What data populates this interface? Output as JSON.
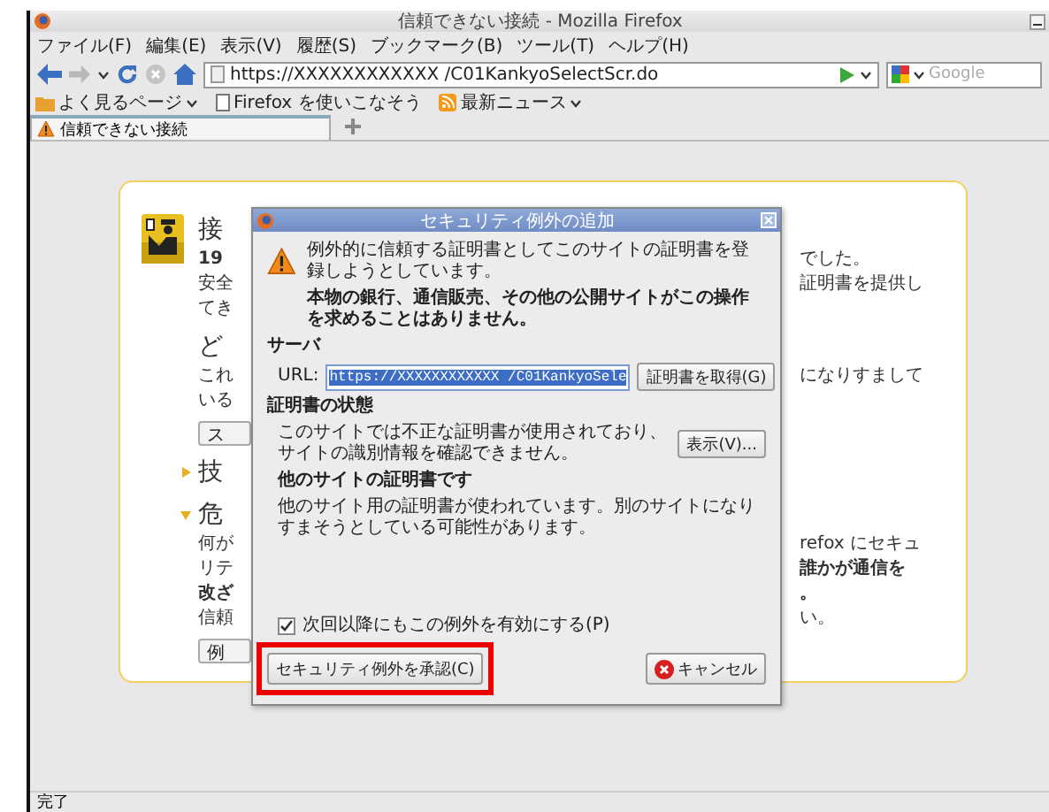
{
  "window": {
    "title": "信頼できない接続 - Mozilla Firefox"
  },
  "menu": [
    "ファイル(F)",
    "編集(E)",
    "表示(V)",
    "履歴(S)",
    "ブックマーク(B)",
    "ツール(T)",
    "ヘルプ(H)"
  ],
  "navigation": {
    "url": "https://XXXXXXXXXXXX /C01KankyoSelectScr.do",
    "search": {
      "placeholder": "Google"
    }
  },
  "bookmarks": [
    {
      "label": "よく見るページ",
      "kind": "folder"
    },
    {
      "label": "Firefox を使いこなそう",
      "kind": "page"
    },
    {
      "label": "最新ニュース",
      "kind": "feed"
    }
  ],
  "tabs": [
    {
      "label": "信頼できない接続",
      "selected": true
    }
  ],
  "error_page": {
    "rows": [
      {
        "kind": "heading",
        "left": {
          "text": "接",
          "bold": false
        }
      },
      {
        "kind": "text",
        "left": {
          "text": "19",
          "bold": true
        },
        "right": {
          "text": "でした。",
          "bold": false
        }
      },
      {
        "kind": "text",
        "left": {
          "text": "安全",
          "bold": false
        },
        "right": {
          "text": "証明書を提供し",
          "bold": false
        }
      },
      {
        "kind": "text",
        "left": {
          "text": "てき",
          "bold": false
        }
      },
      {
        "kind": "heading",
        "left": {
          "text": "ど",
          "bold": false
        }
      },
      {
        "kind": "text",
        "left": {
          "text": "これ",
          "bold": false
        },
        "right": {
          "text": "になりすまして",
          "bold": false
        }
      },
      {
        "kind": "text",
        "left": {
          "text": "いる",
          "bold": false
        }
      },
      {
        "kind": "button",
        "left": {
          "text": "ス",
          "bold": false
        }
      },
      {
        "kind": "toggle",
        "expanded": false,
        "left": {
          "text": "技",
          "bold": false
        }
      },
      {
        "kind": "toggle",
        "expanded": true,
        "left": {
          "text": "危",
          "bold": false
        }
      },
      {
        "kind": "text",
        "left": {
          "text": "何が",
          "bold": false
        },
        "right": {
          "text": "refox にセキュ",
          "bold": false
        }
      },
      {
        "kind": "text",
        "left": {
          "text": "リテ",
          "bold": false
        },
        "right": {
          "text": "誰かが通信を",
          "bold": true
        }
      },
      {
        "kind": "text",
        "left": {
          "text": "改ざ",
          "bold": true
        },
        "right": {
          "text": "。",
          "bold": true
        }
      },
      {
        "kind": "text",
        "left": {
          "text": "信頼",
          "bold": false
        },
        "right": {
          "text": "い。",
          "bold": false
        }
      },
      {
        "kind": "button",
        "left": {
          "text": "例",
          "bold": false
        }
      }
    ]
  },
  "dialog": {
    "title": "セキュリティ例外の追加",
    "intro": "例外的に信頼する証明書としてこのサイトの証明書を登録しようとしています。",
    "warning": "本物の銀行、通信販売、その他の公開サイトがこの操作を求めることはありません。",
    "server_label": "サーバ",
    "url_label": "URL:",
    "url_value": "https://XXXXXXXXXXXX /C01KankyoSele",
    "get_certificate_button": "証明書を取得(G)",
    "status_heading": "証明書の状態",
    "status_text": "このサイトでは不正な証明書が使用されており、サイトの識別情報を確認できません。",
    "view_button": "表示(V)...",
    "problem_heading": "他のサイトの証明書です",
    "problem_text": "他のサイト用の証明書が使われています。別のサイトになりすまそうとしている可能性があります。",
    "permanent": {
      "label": "次回以降にもこの例外を有効にする(P)",
      "checked": true
    },
    "confirm_button": {
      "label": "セキュリティ例外を承認(C)",
      "highlighted": true
    },
    "cancel_button": "キャンセル"
  },
  "status_bar": "完了"
}
